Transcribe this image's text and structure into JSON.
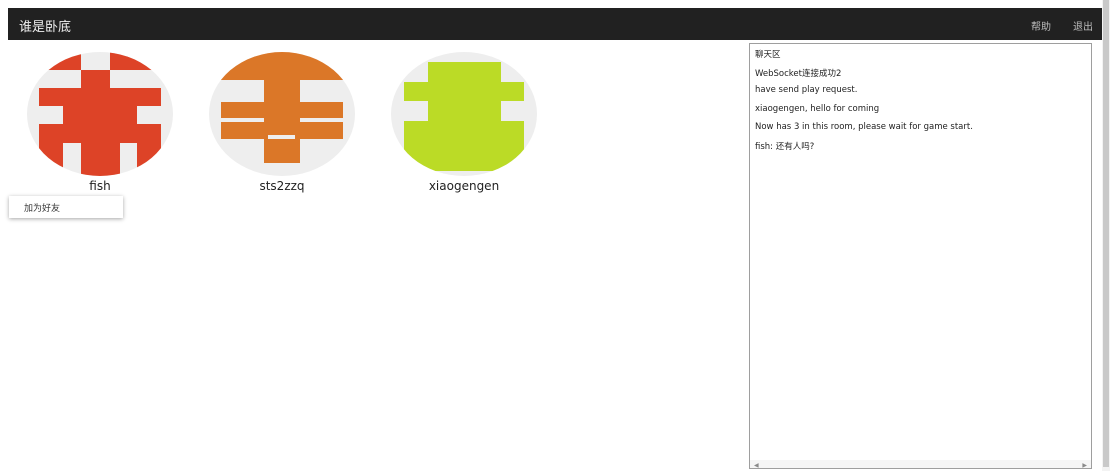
{
  "header": {
    "title": "谁是卧底",
    "help_label": "帮助",
    "logout_label": "退出"
  },
  "players": [
    {
      "name": "fish",
      "avatar_color": "#dd4327"
    },
    {
      "name": "sts2zzq",
      "avatar_color": "#db7728"
    },
    {
      "name": "xiaogengen",
      "avatar_color": "#bbdb26"
    }
  ],
  "context_menu": {
    "add_friend_label": "加为好友"
  },
  "chat": {
    "messages": [
      "聊天区",
      "WebSocket连接成功2",
      "have send play request.",
      "xiaogengen, hello for coming",
      "Now has 3 in this room, please wait for game start.",
      "fish: 还有人吗?"
    ],
    "scroll_left_glyph": "◀",
    "scroll_right_glyph": "▶"
  },
  "colors": {
    "topbar": "#212121",
    "avatar_bg": "#eeeeee"
  }
}
